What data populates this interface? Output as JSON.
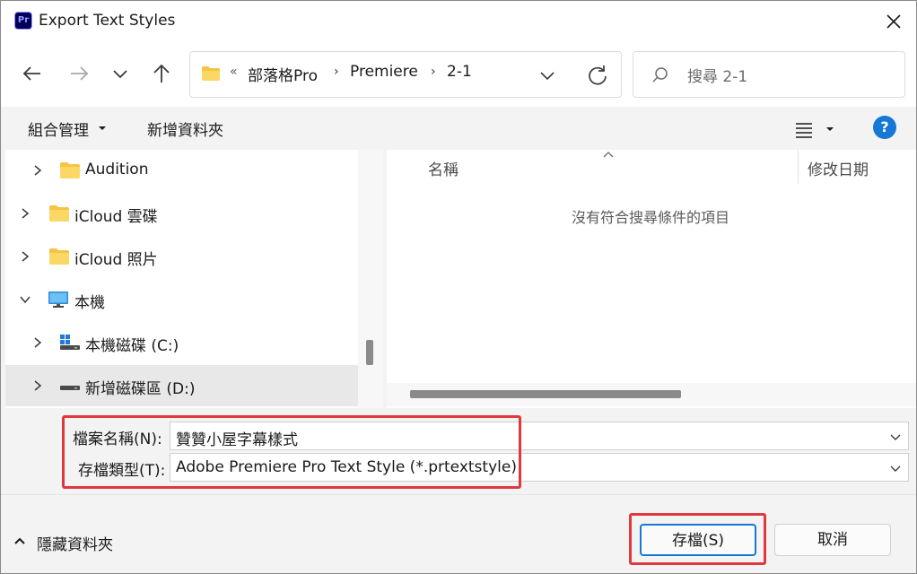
{
  "window": {
    "app_icon_text": "Pr",
    "title": "Export Text Styles"
  },
  "address_bar": {
    "overflow_glyph": "«",
    "breadcrumbs": [
      "部落格Pro",
      "Premiere",
      "2-1"
    ],
    "separator": "›"
  },
  "search": {
    "placeholder": "搜尋 2-1"
  },
  "command_bar": {
    "organize_label": "組合管理",
    "new_folder_label": "新增資料夾",
    "help_label": "?"
  },
  "nav_tree": {
    "items": [
      {
        "label": "Audition",
        "icon": "folder-icon",
        "expanded": false,
        "selected": false
      },
      {
        "label": "iCloud 雲碟",
        "icon": "folder-icon",
        "expanded": false,
        "selected": false
      },
      {
        "label": "iCloud 照片",
        "icon": "folder-icon",
        "expanded": false,
        "selected": false
      },
      {
        "label": "本機",
        "icon": "computer-icon",
        "expanded": true,
        "selected": false
      },
      {
        "label": "本機磁碟 (C:)",
        "icon": "windows-drive-icon",
        "expanded": false,
        "selected": false
      },
      {
        "label": "新增磁碟區 (D:)",
        "icon": "drive-icon",
        "expanded": false,
        "selected": true
      }
    ]
  },
  "file_list": {
    "columns": [
      "名稱",
      "修改日期"
    ],
    "empty_message": "沒有符合搜尋條件的項目"
  },
  "form": {
    "filename_label": "檔案名稱(N):",
    "filename_value": "贊贊小屋字幕樣式",
    "filetype_label": "存檔類型(T):",
    "filetype_value": "Adobe Premiere Pro Text Style (*.prtextstyle)"
  },
  "footer": {
    "hide_folders_label": "隱藏資料夾",
    "save_label": "存檔(S)",
    "cancel_label": "取消"
  },
  "colors": {
    "accent": "#1478d4",
    "highlight_box": "#e0383f",
    "folder": "#f6c343",
    "premiere_bg": "#00005b",
    "premiere_fg": "#9999ff"
  }
}
